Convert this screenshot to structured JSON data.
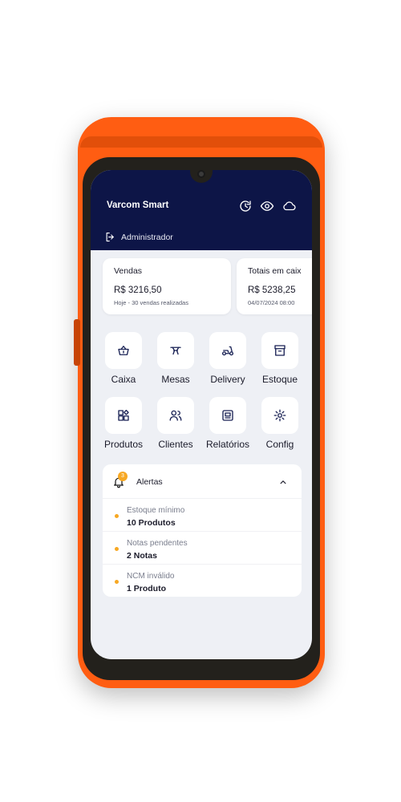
{
  "app": {
    "title": "Varcom Smart",
    "user": "Administrador"
  },
  "header_icons": [
    "refresh-icon",
    "eye-icon",
    "cloud-icon"
  ],
  "cards": [
    {
      "title": "Vendas",
      "value": "R$ 3216,50",
      "subtitle": "Hoje - 30 vendas realizadas"
    },
    {
      "title": "Totais em caix",
      "value": "R$ 5238,25",
      "subtitle": "04/07/2024 08:00"
    }
  ],
  "menu": [
    {
      "label": "Caixa",
      "icon": "basket-icon"
    },
    {
      "label": "Mesas",
      "icon": "table-icon"
    },
    {
      "label": "Delivery",
      "icon": "scooter-icon"
    },
    {
      "label": "Estoque",
      "icon": "archive-icon"
    },
    {
      "label": "Produtos",
      "icon": "apps-icon"
    },
    {
      "label": "Clientes",
      "icon": "users-icon"
    },
    {
      "label": "Relatórios",
      "icon": "report-icon"
    },
    {
      "label": "Config",
      "icon": "gear-icon"
    }
  ],
  "alerts": {
    "title": "Alertas",
    "badge": "3",
    "items": [
      {
        "label": "Estoque mínimo",
        "value": "10 Produtos"
      },
      {
        "label": "Notas pendentes",
        "value": "2 Notas"
      },
      {
        "label": "NCM inválido",
        "value": "1 Produto"
      }
    ]
  },
  "colors": {
    "header": "#0d1547",
    "device": "#ff5d12",
    "accent": "#f7a823",
    "background": "#eef0f5"
  }
}
